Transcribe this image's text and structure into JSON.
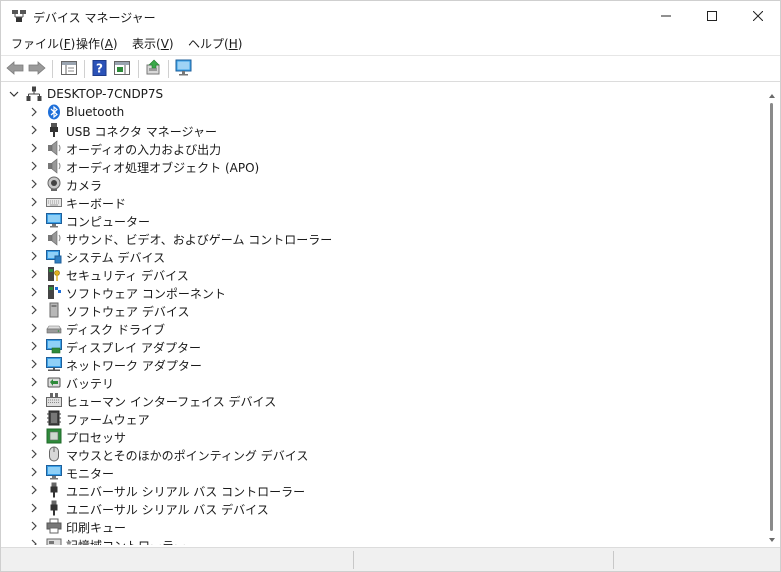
{
  "window": {
    "title": "デバイス マネージャー",
    "icons": {
      "app": "device-manager-icon",
      "minimize": "minimize-icon",
      "maximize": "maximize-icon",
      "close": "close-icon"
    }
  },
  "menu": [
    {
      "label": "ファイル(",
      "accel": "F",
      "end": ")"
    },
    {
      "label": "操作(",
      "accel": "A",
      "end": ")"
    },
    {
      "label": "表示(",
      "accel": "V",
      "end": ")"
    },
    {
      "label": "ヘルプ(",
      "accel": "H",
      "end": ")"
    }
  ],
  "toolbar": {
    "buttons": [
      "back-icon",
      "forward-icon",
      "show-hide-console-tree-icon",
      "help-icon",
      "action-pane-icon",
      "update-driver-icon",
      "scan-hardware-icon"
    ]
  },
  "tree": {
    "root": {
      "label": "DESKTOP-7CNDP7S",
      "icon": "computer-tree-icon",
      "expanded": true
    },
    "categories": [
      {
        "label": "Bluetooth",
        "icon": "bluetooth-icon"
      },
      {
        "label": "USB コネクタ マネージャー",
        "icon": "usb-connector-icon"
      },
      {
        "label": "オーディオの入力および出力",
        "icon": "speaker-icon"
      },
      {
        "label": "オーディオ処理オブジェクト (APO)",
        "icon": "speaker-icon"
      },
      {
        "label": "カメラ",
        "icon": "camera-icon"
      },
      {
        "label": "キーボード",
        "icon": "keyboard-icon"
      },
      {
        "label": "コンピューター",
        "icon": "monitor-icon"
      },
      {
        "label": "サウンド、ビデオ、およびゲーム コントローラー",
        "icon": "speaker-icon"
      },
      {
        "label": "システム デバイス",
        "icon": "system-device-icon"
      },
      {
        "label": "セキュリティ デバイス",
        "icon": "security-device-icon"
      },
      {
        "label": "ソフトウェア コンポーネント",
        "icon": "software-component-icon"
      },
      {
        "label": "ソフトウェア デバイス",
        "icon": "software-device-icon"
      },
      {
        "label": "ディスク ドライブ",
        "icon": "disk-drive-icon"
      },
      {
        "label": "ディスプレイ アダプター",
        "icon": "display-adapter-icon"
      },
      {
        "label": "ネットワーク アダプター",
        "icon": "network-adapter-icon"
      },
      {
        "label": "バッテリ",
        "icon": "battery-icon"
      },
      {
        "label": "ヒューマン インターフェイス デバイス",
        "icon": "hid-icon"
      },
      {
        "label": "ファームウェア",
        "icon": "firmware-icon"
      },
      {
        "label": "プロセッサ",
        "icon": "processor-icon"
      },
      {
        "label": "マウスとそのほかのポインティング デバイス",
        "icon": "mouse-icon"
      },
      {
        "label": "モニター",
        "icon": "monitor-icon"
      },
      {
        "label": "ユニバーサル シリアル バス コントローラー",
        "icon": "usb-icon"
      },
      {
        "label": "ユニバーサル シリアル バス デバイス",
        "icon": "usb-icon"
      },
      {
        "label": "印刷キュー",
        "icon": "printer-icon"
      },
      {
        "label": "記憶域コントローラー",
        "icon": "storage-controller-icon"
      }
    ]
  },
  "colors": {
    "accent_blue": "#1e6fd9",
    "monitor_blue": "#3aa0e8",
    "green": "#2e8b3a",
    "dark": "#333333"
  }
}
